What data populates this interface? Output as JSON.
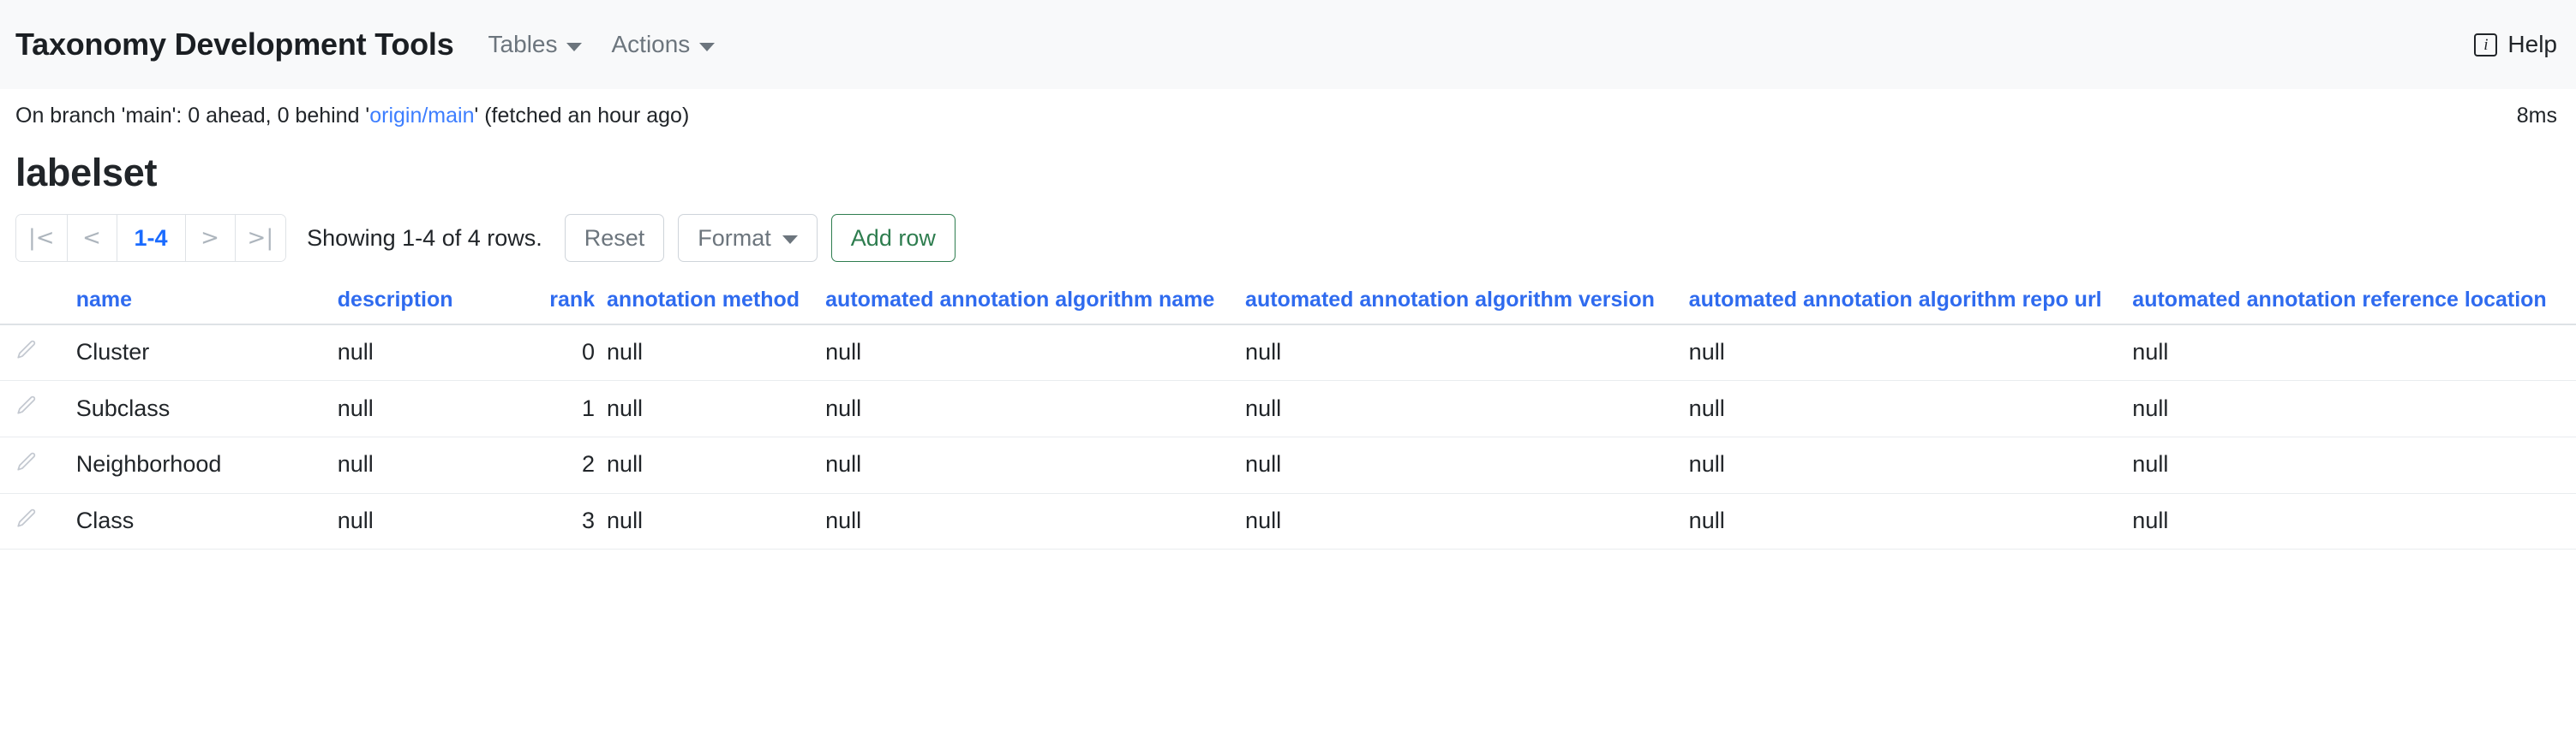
{
  "navbar": {
    "brand": "Taxonomy Development Tools",
    "menus": [
      {
        "label": "Tables",
        "icon": "chevron-down-icon"
      },
      {
        "label": "Actions",
        "icon": "chevron-down-icon"
      }
    ],
    "help": {
      "label": "Help",
      "icon": "info-icon",
      "icon_glyph": "i"
    }
  },
  "branch_status": {
    "prefix": "On branch 'main': 0 ahead, 0 behind '",
    "remote": "origin/main",
    "suffix": "' (fetched an hour ago)",
    "timing": "8ms",
    "link_color": "#3d7eff"
  },
  "page": {
    "title": "labelset"
  },
  "toolbar": {
    "pager": {
      "first_label": "|<",
      "prev_label": "<",
      "current_label": "1-4",
      "next_label": ">",
      "last_label": ">|",
      "current_color": "#1a6bff"
    },
    "showing": "Showing 1-4 of 4 rows.",
    "reset_label": "Reset",
    "format_label": "Format",
    "format_icon": "chevron-down-icon",
    "add_row_label": "Add row",
    "add_row_color": "#2e7d4f"
  },
  "table": {
    "header_color": "#2f6bef",
    "null_color": "#ced4da",
    "columns": [
      {
        "key": "edit",
        "label": ""
      },
      {
        "key": "name",
        "label": "name"
      },
      {
        "key": "description",
        "label": "description"
      },
      {
        "key": "rank",
        "label": "rank"
      },
      {
        "key": "annotation_method",
        "label": "annotation method"
      },
      {
        "key": "automated_annotation_algorithm_name",
        "label": "automated annotation algorithm name"
      },
      {
        "key": "automated_annotation_algorithm_version",
        "label": "automated annotation algorithm version"
      },
      {
        "key": "automated_annotation_algorithm_repo_url",
        "label": "automated annotation algorithm repo url"
      },
      {
        "key": "automated_annotation_reference_location",
        "label": "automated annotation reference location"
      }
    ],
    "rows": [
      {
        "edit_icon": "pencil-icon",
        "name": "Cluster",
        "description": "null",
        "rank": "0",
        "annotation_method": "null",
        "automated_annotation_algorithm_name": "null",
        "automated_annotation_algorithm_version": "null",
        "automated_annotation_algorithm_repo_url": "null",
        "automated_annotation_reference_location": "null"
      },
      {
        "edit_icon": "pencil-icon",
        "name": "Subclass",
        "description": "null",
        "rank": "1",
        "annotation_method": "null",
        "automated_annotation_algorithm_name": "null",
        "automated_annotation_algorithm_version": "null",
        "automated_annotation_algorithm_repo_url": "null",
        "automated_annotation_reference_location": "null"
      },
      {
        "edit_icon": "pencil-icon",
        "name": "Neighborhood",
        "description": "null",
        "rank": "2",
        "annotation_method": "null",
        "automated_annotation_algorithm_name": "null",
        "automated_annotation_algorithm_version": "null",
        "automated_annotation_algorithm_repo_url": "null",
        "automated_annotation_reference_location": "null"
      },
      {
        "edit_icon": "pencil-icon",
        "name": "Class",
        "description": "null",
        "rank": "3",
        "annotation_method": "null",
        "automated_annotation_algorithm_name": "null",
        "automated_annotation_algorithm_version": "null",
        "automated_annotation_algorithm_repo_url": "null",
        "automated_annotation_reference_location": "null"
      }
    ]
  }
}
